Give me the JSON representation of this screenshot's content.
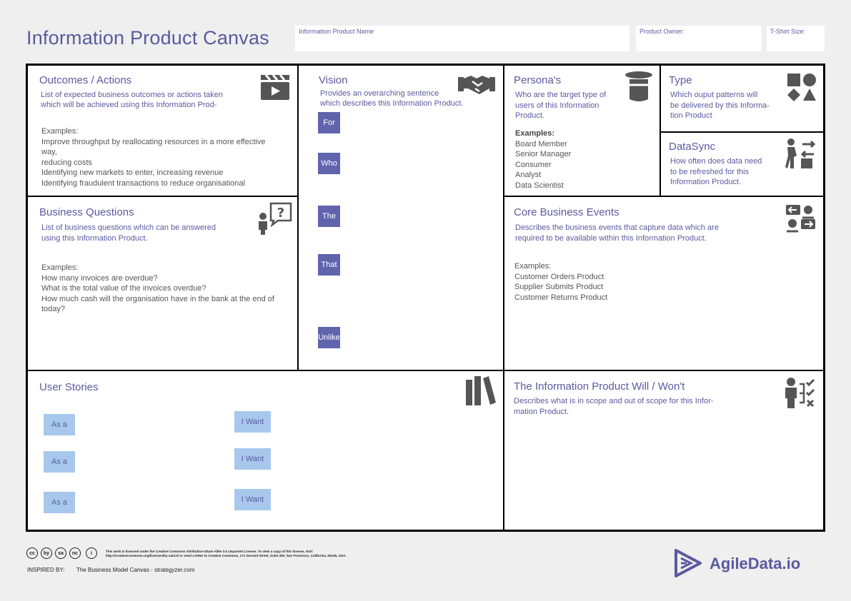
{
  "header": {
    "title": "Information Product Canvas",
    "product_name_label": "Information Product Name",
    "product_owner_label": "Product Owner:",
    "tshirt_label": "T-Shirt Size:"
  },
  "outcomes": {
    "title": "Outcomes / Actions",
    "desc1": "List of expected business outcomes or actions taken",
    "desc2": "which will be achieved using this Information Prod-",
    "examples": [
      "Examples:",
      "Improve throughput by reallocating resources in a more effective",
      "way,",
      "reducing costs",
      "Identifying new markets to enter, increasing revenue",
      "Identifying fraudulent transactions to reduce organisational"
    ]
  },
  "vision": {
    "title": "Vision",
    "desc1": "Provides an overarching sentence",
    "desc2": "which describes this Information Product.",
    "tags": [
      "For",
      "Who",
      "The",
      "That",
      "Unlike"
    ]
  },
  "personas": {
    "title": "Persona's",
    "desc": [
      "Who are the target type of",
      "users of this Information",
      "Product."
    ],
    "examples_label": "Examples:",
    "examples": [
      "Board Member",
      "Senior Manager",
      "Consumer",
      "Analyst",
      "Data Scientist"
    ]
  },
  "type": {
    "title": "Type",
    "desc": [
      "Which ouput patterns will",
      "be delivered by this Informa-",
      "tion Product"
    ]
  },
  "datasync": {
    "title": "DataSync",
    "desc": [
      "How often does data need",
      "to be refreshed for this",
      "Information Product."
    ]
  },
  "business_questions": {
    "title": "Business Questions",
    "desc": [
      "List of business questions which can be answered",
      "using this Information Product."
    ],
    "examples": [
      "Examples:",
      "How many invoices are overdue?",
      "What is the total value of the invoices overdue?",
      "How much cash will the organisation have in the bank at the end of",
      "today?"
    ]
  },
  "core_events": {
    "title": "Core Business Events",
    "desc": [
      "Describes the business events that capture data which are",
      "required to be available within this Information Product."
    ],
    "examples": [
      "Examples:",
      "Customer Orders Product",
      "Supplier Submits Product",
      "Customer Returns Product"
    ]
  },
  "user_stories": {
    "title": "User Stories",
    "as_a": [
      "As a",
      "As a",
      "As a"
    ],
    "i_want": [
      "I Want",
      "I Want",
      "I Want"
    ]
  },
  "will_wont": {
    "title": "The Information Product Will / Won't",
    "desc": [
      "Describes what is in scope and out of scope for this Infor-",
      "mation Product."
    ]
  },
  "footer": {
    "cc_icons": [
      "cc",
      "by",
      "sa",
      "nc",
      "i"
    ],
    "license1": "This work is licensed under the Creative Commons Attribution-Share Alike 3.0 Unported License. To view a copy of this license, visit:",
    "license2": "http://creativecommons.org/licenses/by-sa/3.0/ or send a letter to Creative Commons, 171 Second Street, Suite 300, San Francisco, California, 94105, USA.",
    "inspired_label": "INSPIRED BY:",
    "inspired_text": "The Business Model Canvas - strategyzer.com",
    "brand": "AgileData.io"
  },
  "colors": {
    "accent": "#5a5aa0",
    "tag": "#6064ad",
    "sticky": "#a7c8ec",
    "icon": "#555555"
  }
}
